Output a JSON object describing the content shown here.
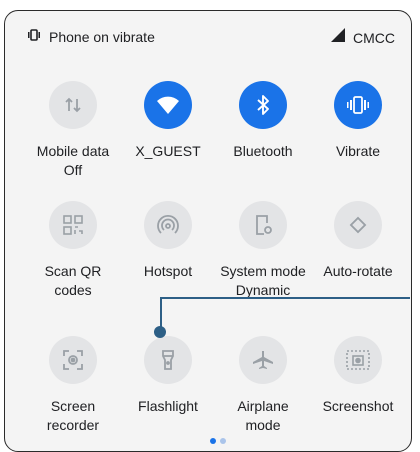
{
  "status": {
    "left_text": "Phone on vibrate",
    "carrier": "CMCC"
  },
  "tiles": [
    {
      "label": "Mobile data\nOff",
      "icon": "mobile-data-icon",
      "active": false
    },
    {
      "label": "X_GUEST",
      "icon": "wifi-icon",
      "active": true
    },
    {
      "label": "Bluetooth",
      "icon": "bluetooth-icon",
      "active": true
    },
    {
      "label": "Vibrate",
      "icon": "vibrate-icon",
      "active": true
    },
    {
      "label": "Scan QR\ncodes",
      "icon": "qr-code-icon",
      "active": false
    },
    {
      "label": "Hotspot",
      "icon": "hotspot-icon",
      "active": false
    },
    {
      "label": "System mode\nDynamic",
      "icon": "system-mode-icon",
      "active": false
    },
    {
      "label": "Auto-rotate",
      "icon": "auto-rotate-icon",
      "active": false
    },
    {
      "label": "Screen\nrecorder",
      "icon": "screen-recorder-icon",
      "active": false
    },
    {
      "label": "Flashlight",
      "icon": "flashlight-icon",
      "active": false
    },
    {
      "label": "Airplane\nmode",
      "icon": "airplane-icon",
      "active": false
    },
    {
      "label": "Screenshot",
      "icon": "screenshot-icon",
      "active": false
    }
  ],
  "colors": {
    "accent": "#1a73e8",
    "inactive_tile": "#e3e4e6",
    "callout": "#2d5f86"
  }
}
